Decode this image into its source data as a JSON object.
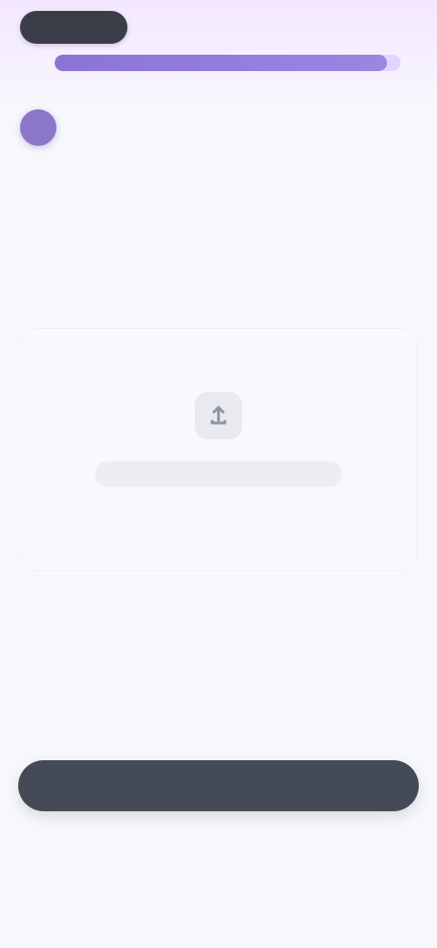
{
  "header": {
    "back_pill_label": "",
    "right_text": "",
    "progress": 0.96
  },
  "chat": {
    "avatar_label": "",
    "role_label": "",
    "question": ""
  },
  "upload": {
    "icon": "upload-icon",
    "text": ""
  },
  "footer": {
    "primary_button_label": "",
    "secondary_link_label": ""
  },
  "colors": {
    "accent": "#8b74d6",
    "primary_button_bg": "#454a57",
    "background": "#f7f8fc"
  }
}
